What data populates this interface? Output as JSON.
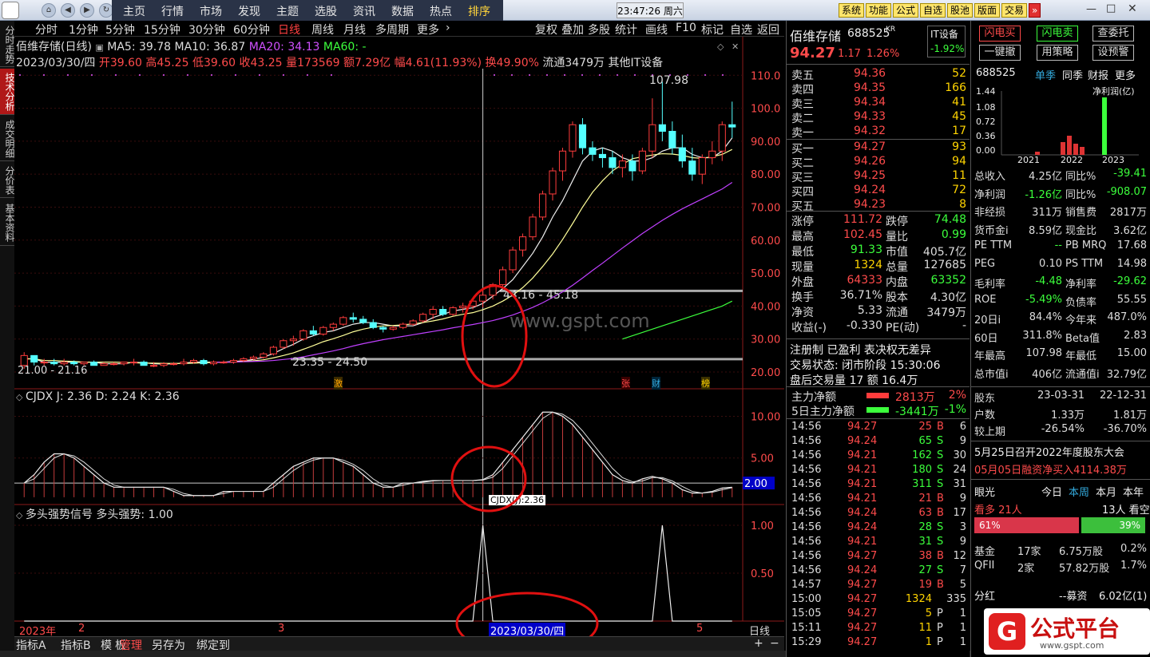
{
  "topbar": {
    "menus": [
      "主页",
      "行情",
      "市场",
      "发现",
      "主题",
      "选股",
      "资讯",
      "数据",
      "热点",
      "排序"
    ],
    "clock": "23:47:26 周六",
    "buttons": [
      "系统",
      "功能",
      "公式",
      "自选",
      "股池",
      "版面",
      "交易"
    ]
  },
  "left_tabs": [
    "分时走势",
    "技术分析",
    "成交明细",
    "分价表",
    "基本资料"
  ],
  "timeframes": [
    "分时",
    "1分钟",
    "5分钟",
    "15分钟",
    "30分钟",
    "60分钟",
    "日线",
    "周线",
    "月线",
    "多周期",
    "更多"
  ],
  "toolbar_right": [
    "复权",
    "叠加",
    "多股",
    "统计",
    "画线",
    "F10",
    "标记",
    "自选",
    "返回"
  ],
  "chart_header": {
    "name": "佰维存储(日线)",
    "ma5": "MA5: 39.78",
    "ma10": "MA10: 36.87",
    "ma20": "MA20: 34.13",
    "ma60": "MA60: -",
    "date": "2023/03/30/四",
    "open": "开39.60",
    "high": "高45.25",
    "low": "低39.60",
    "close": "收43.25",
    "vol": "量173569",
    "amt": "额7.29亿",
    "chg": "幅4.61(11.93%)",
    "turn": "换49.90%",
    "float": "流通3479万",
    "sector": "其他IT设备"
  },
  "price_axis": [
    "110.0",
    "100.0",
    "90.00",
    "80.00",
    "70.00",
    "60.00",
    "50.00",
    "40.00",
    "30.00",
    "20.00"
  ],
  "annotations": {
    "high_label": "107.98",
    "range1": "44.16 - 45.18",
    "range2": "23.35 - 24.50",
    "low_label": "21.00 - 21.16",
    "watermark": "www.gspt.com"
  },
  "markers": [
    "激",
    "张",
    "财",
    "榜"
  ],
  "cjdx": {
    "label": "CJDX J: 2.36 D: 2.24 K: 2.36",
    "axis": [
      "10.00",
      "5.00",
      "2.00"
    ],
    "tooltip": "CJDX(J):2.36"
  },
  "dtqs": {
    "label": "多头强势信号 多头强势: 1.00",
    "axis": [
      "1.00",
      "0.50"
    ]
  },
  "date_axis": {
    "year": "2023年",
    "m2": "2",
    "m3": "3",
    "m5": "5",
    "cursor": "2023/03/30/四",
    "period": "日线"
  },
  "bottom_tabs": [
    "指标A",
    "指标B",
    "模",
    "板",
    "管理",
    "另存为",
    "绑定到"
  ],
  "stock": {
    "name": "佰维存储",
    "code": "688525",
    "kr": "KR",
    "sector": "IT设备",
    "sector_chg": "-1.92%",
    "price": "94.27",
    "chg": "1.17",
    "pct": "1.26%"
  },
  "asks": [
    {
      "label": "卖五",
      "price": "94.36",
      "vol": "52"
    },
    {
      "label": "卖四",
      "price": "94.35",
      "vol": "166"
    },
    {
      "label": "卖三",
      "price": "94.34",
      "vol": "41"
    },
    {
      "label": "卖二",
      "price": "94.33",
      "vol": "45"
    },
    {
      "label": "卖一",
      "price": "94.32",
      "vol": "17"
    }
  ],
  "bids": [
    {
      "label": "买一",
      "price": "94.27",
      "vol": "93"
    },
    {
      "label": "买二",
      "price": "94.26",
      "vol": "94"
    },
    {
      "label": "买三",
      "price": "94.25",
      "vol": "11"
    },
    {
      "label": "买四",
      "price": "94.24",
      "vol": "72"
    },
    {
      "label": "买五",
      "price": "94.23",
      "vol": "8"
    }
  ],
  "quote": [
    [
      "涨停",
      "111.72",
      "跌停",
      "74.48"
    ],
    [
      "最高",
      "102.45",
      "量比",
      "0.99"
    ],
    [
      "最低",
      "91.33",
      "市值",
      "405.7亿"
    ],
    [
      "现量",
      "1324",
      "总量",
      "127685"
    ],
    [
      "外盘",
      "64333",
      "内盘",
      "63352"
    ],
    [
      "换手",
      "36.71%",
      "股本",
      "4.30亿"
    ],
    [
      "净资",
      "5.33",
      "流通",
      "3479万"
    ],
    [
      "收益(-)",
      "-0.330",
      "PE(动)",
      "-"
    ]
  ],
  "status": {
    "tags": "注册制 已盈利 表决权无差异",
    "trade": "交易状态: 闭市阶段 15:30:06",
    "after": "盘后交易量 17 额 16.4万"
  },
  "capital": [
    {
      "label": "主力净额",
      "value": "2813万",
      "pct": "2%"
    },
    {
      "label": "5日主力净额",
      "value": "-3441万",
      "pct": "-1%"
    }
  ],
  "ticks": [
    [
      "14:56",
      "94.27",
      "25",
      "B",
      "6"
    ],
    [
      "14:56",
      "94.24",
      "65",
      "S",
      "9"
    ],
    [
      "14:56",
      "94.21",
      "162",
      "S",
      "30"
    ],
    [
      "14:56",
      "94.21",
      "180",
      "S",
      "24"
    ],
    [
      "14:56",
      "94.21",
      "311",
      "S",
      "31"
    ],
    [
      "14:56",
      "94.21",
      "21",
      "B",
      "9"
    ],
    [
      "14:56",
      "94.24",
      "63",
      "B",
      "17"
    ],
    [
      "14:56",
      "94.24",
      "28",
      "S",
      "3"
    ],
    [
      "14:56",
      "94.21",
      "31",
      "S",
      "9"
    ],
    [
      "14:56",
      "94.27",
      "38",
      "B",
      "12"
    ],
    [
      "14:56",
      "94.24",
      "27",
      "S",
      "7"
    ],
    [
      "14:57",
      "94.27",
      "19",
      "B",
      "5"
    ],
    [
      "15:00",
      "94.27",
      "1324",
      "",
      "335"
    ],
    [
      "15:05",
      "94.27",
      "5",
      "P",
      "1"
    ],
    [
      "15:11",
      "94.27",
      "11",
      "P",
      "1"
    ],
    [
      "15:29",
      "94.27",
      "1",
      "P",
      "1"
    ]
  ],
  "f10": {
    "buttons": [
      "闪电买",
      "闪电卖",
      "查委托",
      "一键撤",
      "用策略",
      "设预警"
    ],
    "code": "688525",
    "tabs": [
      "单季",
      "同季",
      "财报",
      "更多"
    ],
    "profit_title": "净利润(亿)",
    "profit_axis": [
      "1.44",
      "1.08",
      "0.72",
      "0.36",
      "0.00"
    ],
    "years": [
      "2021",
      "2022",
      "2023"
    ],
    "fin": [
      [
        "总收入",
        "4.25亿",
        "同比%",
        "-39.41"
      ],
      [
        "净利润",
        "-1.26亿",
        "同比%",
        "-908.07"
      ],
      [
        "非经损",
        "311万",
        "销售费",
        "2817万"
      ],
      [
        "货币金i",
        "8.59亿",
        "现金比",
        "3.62亿"
      ],
      [
        "PE TTM",
        "--",
        "PB MRQ",
        "17.68"
      ],
      [
        "PEG",
        "0.10",
        "PS TTM",
        "14.98"
      ],
      [
        "毛利率",
        "-4.48",
        "净利率",
        "-29.62"
      ],
      [
        "ROE",
        "-5.49%",
        "负债率",
        "55.55"
      ],
      [
        "20日i",
        "84.4%",
        "今年来",
        "487.0%"
      ],
      [
        "60日",
        "311.8%",
        "Beta值",
        "2.83"
      ],
      [
        "年最高",
        "107.98",
        "年最低",
        "15.00"
      ],
      [
        "总市值i",
        "406亿",
        "流通值i",
        "32.79亿"
      ]
    ],
    "holders": [
      [
        "股东",
        "23-03-31",
        "22-12-31"
      ],
      [
        "户数",
        "1.33万",
        "1.81万"
      ],
      [
        "较上期",
        "-26.54%",
        "-36.70%"
      ]
    ],
    "news": [
      "5月25日召开2022年度股东大会",
      "05月05日融资净买入4114.38万"
    ],
    "eye": {
      "title": "眼光",
      "tabs": [
        "今日",
        "本周",
        "本月",
        "本年"
      ],
      "bull": "看多 21人",
      "bear": "13人 看空",
      "bull_pct": "61%",
      "bear_pct": "39%",
      "bull_ratio": 0.61
    },
    "funds": [
      [
        "基金",
        "17家",
        "6.75万股",
        "0.2%"
      ],
      [
        "QFII",
        "2家",
        "57.82万股",
        "1.7%"
      ]
    ],
    "dividend": [
      "分红",
      "--募资",
      "6.02亿(1)"
    ],
    "logo": {
      "text": "公式平台",
      "url": "www.gspt.com"
    }
  },
  "chart_data": {
    "type": "candlestick",
    "y_range": [
      20,
      112
    ],
    "candles": [
      [
        22,
        26,
        21,
        25
      ],
      [
        25,
        25,
        22,
        23
      ],
      [
        23,
        24,
        22,
        23
      ],
      [
        23,
        24,
        22,
        22.5
      ],
      [
        22.5,
        24,
        22,
        23
      ],
      [
        23,
        23.5,
        22,
        22.5
      ],
      [
        22.5,
        23,
        22,
        23
      ],
      [
        23,
        23.5,
        22,
        22
      ],
      [
        22,
        23,
        22,
        22.5
      ],
      [
        22.5,
        23,
        22,
        22.5
      ],
      [
        22.5,
        23,
        22,
        23
      ],
      [
        23,
        24,
        22,
        23
      ],
      [
        23,
        23.5,
        22,
        22
      ],
      [
        22,
        23,
        21.5,
        22
      ],
      [
        22,
        23,
        21.5,
        22.5
      ],
      [
        22.5,
        23,
        22,
        22.5
      ],
      [
        22.5,
        24,
        22,
        23
      ],
      [
        23,
        24,
        22.5,
        23.5
      ],
      [
        23.5,
        24,
        22,
        22.5
      ],
      [
        22.5,
        23.5,
        22,
        23
      ],
      [
        23,
        23.5,
        22.5,
        23
      ],
      [
        23,
        24,
        22.5,
        23.5
      ],
      [
        23.5,
        24.5,
        23,
        24
      ],
      [
        24,
        25,
        23.5,
        24.5
      ],
      [
        24.5,
        26,
        24,
        25.5
      ],
      [
        25.5,
        28,
        25,
        27.5
      ],
      [
        27.5,
        30,
        27,
        29.5
      ],
      [
        29.5,
        31,
        28,
        30
      ],
      [
        30,
        33,
        29.5,
        32.5
      ],
      [
        32.5,
        34,
        31,
        31.5
      ],
      [
        31.5,
        34,
        31,
        33.5
      ],
      [
        33.5,
        35,
        32.5,
        34.5
      ],
      [
        34.5,
        37,
        34,
        36.5
      ],
      [
        36.5,
        38,
        35,
        36
      ],
      [
        36,
        37,
        34.5,
        35
      ],
      [
        35,
        36,
        33,
        33.5
      ],
      [
        33.5,
        34,
        32,
        33
      ],
      [
        33,
        34,
        32.5,
        33.5
      ],
      [
        33.5,
        35,
        33,
        34.5
      ],
      [
        34.5,
        36,
        34,
        35.5
      ],
      [
        35.5,
        38,
        35,
        37.5
      ],
      [
        37.5,
        40,
        36,
        39
      ],
      [
        39,
        40,
        37,
        37.5
      ],
      [
        37.5,
        40,
        37,
        39.5
      ],
      [
        39.5,
        41,
        38,
        40
      ],
      [
        40,
        42,
        39,
        41.5
      ],
      [
        41.5,
        45.2,
        39.6,
        43.3
      ],
      [
        43.3,
        47,
        42,
        46.5
      ],
      [
        46.5,
        52,
        46,
        51
      ],
      [
        51,
        58,
        50,
        57
      ],
      [
        57,
        62,
        55,
        61
      ],
      [
        61,
        68,
        60,
        67
      ],
      [
        67,
        75,
        66,
        74
      ],
      [
        74,
        82,
        72,
        81
      ],
      [
        81,
        88,
        78,
        87
      ],
      [
        87,
        96,
        85,
        95
      ],
      [
        95,
        97,
        86,
        88
      ],
      [
        88,
        90,
        84,
        86
      ],
      [
        86,
        88,
        82,
        85
      ],
      [
        85,
        87,
        80,
        82
      ],
      [
        82,
        86,
        79,
        84
      ],
      [
        84,
        86,
        78,
        81
      ],
      [
        81,
        88,
        80,
        87
      ],
      [
        87,
        103,
        85,
        95
      ],
      [
        95,
        108,
        90,
        93
      ],
      [
        93,
        96,
        86,
        88
      ],
      [
        88,
        92,
        82,
        84
      ],
      [
        84,
        88,
        78,
        80
      ],
      [
        80,
        86,
        77,
        85
      ],
      [
        85,
        90,
        83,
        87
      ],
      [
        87,
        96,
        84,
        95
      ],
      [
        95,
        102,
        91,
        94.3
      ]
    ],
    "ma5": [
      24,
      24,
      23,
      23,
      23,
      23,
      23,
      23,
      22.5,
      22.5,
      22.5,
      23,
      22.8,
      22.5,
      22.4,
      22.5,
      22.7,
      23,
      23,
      23,
      23,
      23.2,
      23.4,
      23.8,
      24.5,
      25.6,
      27.1,
      28.4,
      30,
      31,
      32,
      32.5,
      33.5,
      34.5,
      35,
      35,
      34.5,
      34,
      34,
      34,
      35,
      36.5,
      37.5,
      38.5,
      39,
      39.5,
      40.8,
      43,
      45.3,
      48,
      52,
      56,
      61,
      67,
      72,
      78,
      84,
      87,
      88,
      87,
      85,
      84,
      84,
      85,
      87,
      88,
      88,
      86,
      85,
      85,
      87,
      91
    ],
    "ma10": [
      24,
      24,
      23.5,
      23.5,
      23.3,
      23.2,
      23,
      23,
      23,
      23,
      22.9,
      22.8,
      22.7,
      22.7,
      22.6,
      22.6,
      22.6,
      22.7,
      22.8,
      22.9,
      23,
      23,
      23.2,
      23.4,
      23.7,
      24.3,
      25,
      25.8,
      26.9,
      28,
      29.2,
      30.1,
      31.1,
      32.2,
      33,
      33.6,
      34,
      34.1,
      34.3,
      34.6,
      35,
      35.5,
      36.1,
      36.9,
      37.5,
      38,
      38.9,
      40,
      41.5,
      43.3,
      45.6,
      48.5,
      52,
      55.8,
      60.2,
      65,
      70,
      74.5,
      78,
      81,
      83,
      84.7,
      85.3,
      85.8,
      86.2,
      86.1,
      85.7,
      85,
      84.8,
      85.3,
      86,
      87.5
    ],
    "ma20": [
      null,
      null,
      null,
      null,
      null,
      null,
      null,
      null,
      null,
      null,
      null,
      null,
      null,
      null,
      null,
      null,
      null,
      null,
      null,
      23,
      23,
      23,
      23.1,
      23.2,
      23.3,
      23.5,
      23.8,
      24.1,
      24.6,
      25.2,
      25.8,
      26.4,
      27.1,
      27.9,
      28.6,
      29.2,
      29.8,
      30.3,
      30.8,
      31.3,
      31.8,
      32.3,
      32.8,
      33.4,
      33.9,
      34.4,
      35,
      35.6,
      36.4,
      37.3,
      38.4,
      39.6,
      41,
      42.6,
      44.3,
      46.3,
      48.5,
      50.8,
      53,
      55.3,
      57.6,
      59.8,
      62,
      64,
      66,
      67.8,
      69.5,
      71,
      72.5,
      74,
      75.5,
      77.5
    ],
    "ma60": [
      null,
      null,
      null,
      null,
      null,
      null,
      null,
      null,
      null,
      null,
      null,
      null,
      null,
      null,
      null,
      null,
      null,
      null,
      null,
      null,
      null,
      null,
      null,
      null,
      null,
      null,
      null,
      null,
      null,
      null,
      null,
      null,
      null,
      null,
      null,
      null,
      null,
      null,
      null,
      null,
      null,
      null,
      null,
      null,
      null,
      null,
      null,
      null,
      null,
      null,
      null,
      null,
      null,
      null,
      null,
      null,
      null,
      null,
      null,
      null,
      30,
      31,
      32,
      33,
      34,
      35,
      36,
      37,
      38,
      39,
      40,
      41.5
    ],
    "cjdx_j": [
      2,
      3,
      4.5,
      5.5,
      5.5,
      5,
      4,
      3,
      2,
      1.5,
      1.5,
      1.5,
      1.5,
      1.5,
      1.5,
      1,
      0.5,
      0.5,
      0.5,
      0.5,
      1,
      1,
      1,
      1,
      1,
      2,
      3,
      4,
      4.5,
      5,
      5,
      5,
      4.5,
      4,
      3,
      2,
      1.5,
      1.5,
      2,
      2,
      2.2,
      2.3,
      2.3,
      2.3,
      2.3,
      2.3,
      2.4,
      3,
      4.5,
      6,
      7.5,
      9,
      10.5,
      10.5,
      10,
      9,
      7.5,
      6,
      4.5,
      3,
      2.3,
      2,
      2.5,
      2.8,
      2.5,
      2,
      1.2,
      0.8,
      0.8,
      1,
      1.4,
      1.5
    ],
    "signal": [
      0,
      0,
      0,
      0,
      0,
      0,
      0,
      0,
      0,
      0,
      0,
      0,
      0,
      0,
      0,
      0,
      0,
      0,
      0,
      0,
      0,
      0,
      0,
      0,
      0,
      0,
      0,
      0,
      0,
      0,
      0,
      0,
      0,
      0,
      0,
      0,
      0,
      0,
      0,
      0,
      0,
      0,
      0,
      0,
      0,
      0,
      1,
      0,
      0,
      0,
      0,
      0,
      0,
      0,
      0,
      0,
      0,
      0,
      0,
      0,
      0,
      0,
      0,
      0,
      1,
      0,
      0,
      0,
      0,
      0,
      0,
      0
    ]
  }
}
